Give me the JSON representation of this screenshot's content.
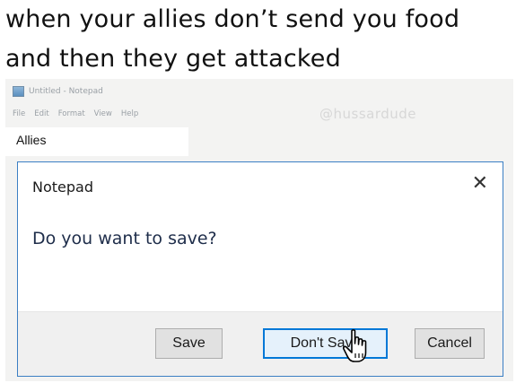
{
  "caption": {
    "line1": "when your allies don’t send you food",
    "line2": "and then they get attacked"
  },
  "window": {
    "title": "Untitled - Notepad",
    "menu": [
      "File",
      "Edit",
      "Format",
      "View",
      "Help"
    ],
    "document_text": "Allies",
    "watermark": "@hussardude"
  },
  "dialog": {
    "title": "Notepad",
    "close_glyph": "✕",
    "question": "Do you want to save?",
    "buttons": {
      "save": "Save",
      "dont_save": "Don't Save",
      "cancel": "Cancel"
    }
  },
  "icons": [
    "notepad-icon",
    "close-icon",
    "hand-cursor-icon"
  ],
  "colors": {
    "dialog_border": "#3b7fc4",
    "focused_button_border": "#0078d7",
    "focused_button_fill": "#e5f1fb",
    "footer_bg": "#f0f0f0"
  }
}
